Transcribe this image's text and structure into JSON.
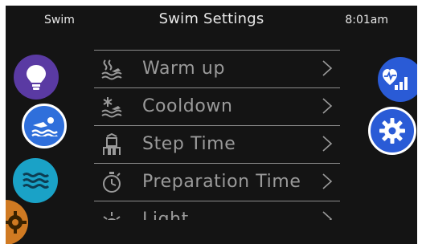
{
  "header": {
    "left_label": "Swim",
    "title": "Swim Settings",
    "time": "8:01am"
  },
  "left_buttons": [
    {
      "name": "light",
      "icon": "lightbulb-icon",
      "color": "#5a3aa3"
    },
    {
      "name": "swim",
      "icon": "swimmer-icon",
      "color": "#2f6fdb"
    },
    {
      "name": "waves",
      "icon": "waves-icon",
      "color": "#1aa2c7"
    },
    {
      "name": "settings",
      "icon": "gear-icon",
      "color": "#d07a22"
    }
  ],
  "right_buttons": [
    {
      "name": "health",
      "icon": "heart-chart-icon",
      "color": "#2a5bd6"
    },
    {
      "name": "settings",
      "icon": "gear-icon",
      "color": "#2a5bd6"
    }
  ],
  "menu": {
    "items": [
      {
        "label": "Warm up",
        "icon": "warm-up-icon"
      },
      {
        "label": "Cooldown",
        "icon": "cooldown-icon"
      },
      {
        "label": "Step Time",
        "icon": "step-time-icon"
      },
      {
        "label": "Preparation Time",
        "icon": "stopwatch-icon"
      },
      {
        "label": "Light",
        "icon": "light-icon"
      }
    ]
  },
  "colors": {
    "screen_bg": "#141414",
    "menu_text": "#9a9a9a",
    "header_text": "#e8e8e8"
  }
}
